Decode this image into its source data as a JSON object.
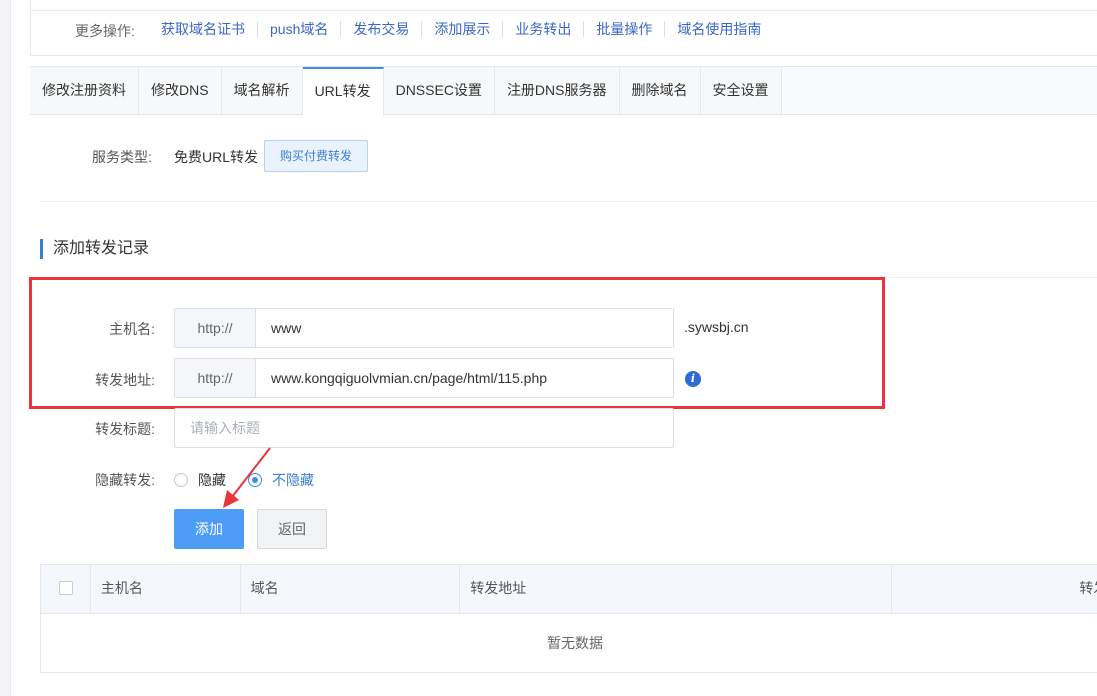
{
  "more_ops": {
    "label": "更多操作:",
    "links": [
      "获取域名证书",
      "push域名",
      "发布交易",
      "添加展示",
      "业务转出",
      "批量操作",
      "域名使用指南"
    ]
  },
  "tabs": [
    "修改注册资料",
    "修改DNS",
    "域名解析",
    "URL转发",
    "DNSSEC设置",
    "注册DNS服务器",
    "删除域名",
    "安全设置"
  ],
  "active_tab": "URL转发",
  "service": {
    "label": "服务类型:",
    "value": "免费URL转发",
    "buy_button": "购买付费转发"
  },
  "section_title": "添加转发记录",
  "form": {
    "host_label": "主机名:",
    "host_prefix": "http://",
    "host_value": "www",
    "host_suffix": ".sywsbj.cn",
    "forward_label": "转发地址:",
    "forward_prefix": "http://",
    "forward_value": "www.kongqiguolvmian.cn/page/html/115.php",
    "title_label": "转发标题:",
    "title_placeholder": "请输入标题",
    "hide_label": "隐藏转发:",
    "hide_options": [
      "隐藏",
      "不隐藏"
    ],
    "hide_selected": "不隐藏",
    "add_button": "添加",
    "back_button": "返回"
  },
  "table": {
    "columns": [
      "主机名",
      "域名",
      "转发地址",
      "转发"
    ],
    "empty_text": "暂无数据"
  },
  "colors": {
    "accent": "#3a8ee6",
    "primary_button": "#4d9cf6",
    "highlight_box": "#e8343a",
    "link": "#3a67c9"
  }
}
